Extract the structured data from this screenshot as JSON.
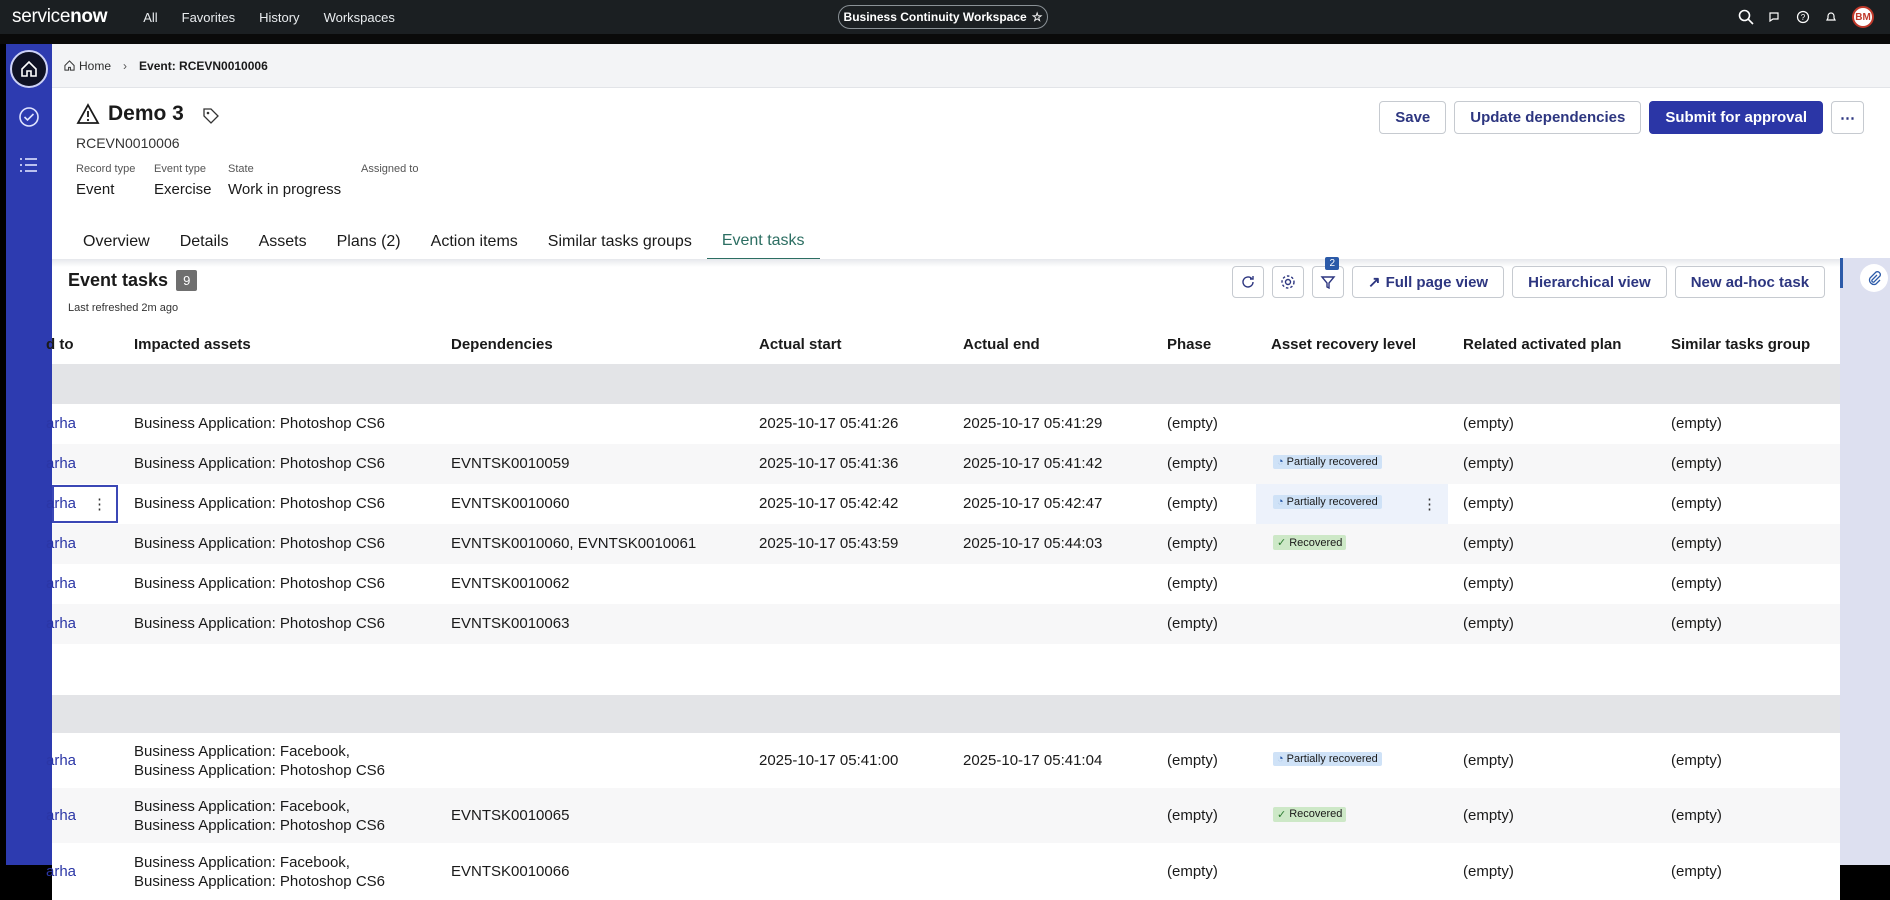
{
  "topnav": {
    "brand_a": "service",
    "brand_b": "now",
    "links": [
      "All",
      "Favorites",
      "History",
      "Workspaces"
    ],
    "workspace": "Business Continuity Workspace",
    "avatar": "BM"
  },
  "breadcrumb": {
    "home": "Home",
    "current": "Event: RCEVN0010006"
  },
  "record": {
    "title": "Demo 3",
    "number": "RCEVN0010006",
    "fields": [
      {
        "label": "Record type",
        "value": "Event"
      },
      {
        "label": "Event type",
        "value": "Exercise"
      },
      {
        "label": "State",
        "value": "Work in progress"
      },
      {
        "label": "Assigned to",
        "value": ""
      }
    ]
  },
  "actions": {
    "save": "Save",
    "update": "Update dependencies",
    "submit": "Submit for approval"
  },
  "tabs": [
    "Overview",
    "Details",
    "Assets",
    "Plans (2)",
    "Action items",
    "Similar tasks groups",
    "Event tasks"
  ],
  "panel": {
    "title": "Event tasks",
    "count": "9",
    "refreshed": "Last refreshed 2m ago",
    "filter_count": "2",
    "full_page": "Full page view",
    "hierarchical": "Hierarchical view",
    "new_task": "New ad-hoc task"
  },
  "columns": [
    "d to",
    "Impacted assets",
    "Dependencies",
    "Actual start",
    "Actual end",
    "Phase",
    "Asset recovery level",
    "Related activated plan",
    "Similar tasks group"
  ],
  "rows": [
    {
      "who": "arha",
      "assets": [
        "Business Application: Photoshop CS6"
      ],
      "deps": "",
      "start": "2025-10-17 05:41:26",
      "end": "2025-10-17 05:41:29",
      "phase": "(empty)",
      "recovery": "",
      "plan": "(empty)",
      "group": "(empty)"
    },
    {
      "who": "arha",
      "assets": [
        "Business Application: Photoshop CS6"
      ],
      "deps": "EVNTSK0010059",
      "start": "2025-10-17 05:41:36",
      "end": "2025-10-17 05:41:42",
      "phase": "(empty)",
      "recovery": "Partially recovered",
      "plan": "(empty)",
      "group": "(empty)"
    },
    {
      "who": "arha",
      "assets": [
        "Business Application: Photoshop CS6"
      ],
      "deps": "EVNTSK0010060",
      "start": "2025-10-17 05:42:42",
      "end": "2025-10-17 05:42:47",
      "phase": "(empty)",
      "recovery": "Partially recovered",
      "plan": "(empty)",
      "group": "(empty)"
    },
    {
      "who": "arha",
      "assets": [
        "Business Application: Photoshop CS6"
      ],
      "deps": "EVNTSK0010060, EVNTSK0010061",
      "start": "2025-10-17 05:43:59",
      "end": "2025-10-17 05:44:03",
      "phase": "(empty)",
      "recovery": "Recovered",
      "plan": "(empty)",
      "group": "(empty)"
    },
    {
      "who": "arha",
      "assets": [
        "Business Application: Photoshop CS6"
      ],
      "deps": "EVNTSK0010062",
      "start": "",
      "end": "",
      "phase": "(empty)",
      "recovery": "",
      "plan": "(empty)",
      "group": "(empty)"
    },
    {
      "who": "arha",
      "assets": [
        "Business Application: Photoshop CS6"
      ],
      "deps": "EVNTSK0010063",
      "start": "",
      "end": "",
      "phase": "(empty)",
      "recovery": "",
      "plan": "(empty)",
      "group": "(empty)"
    },
    {
      "who": "arha",
      "assets": [
        "Business Application: Facebook,",
        "Business Application: Photoshop CS6"
      ],
      "deps": "",
      "start": "2025-10-17 05:41:00",
      "end": "2025-10-17 05:41:04",
      "phase": "(empty)",
      "recovery": "Partially recovered",
      "plan": "(empty)",
      "group": "(empty)"
    },
    {
      "who": "arha",
      "assets": [
        "Business Application: Facebook,",
        "Business Application: Photoshop CS6"
      ],
      "deps": "EVNTSK0010065",
      "start": "",
      "end": "",
      "phase": "(empty)",
      "recovery": "Recovered",
      "plan": "(empty)",
      "group": "(empty)"
    },
    {
      "who": "arha",
      "assets": [
        "Business Application: Facebook,",
        "Business Application: Photoshop CS6"
      ],
      "deps": "EVNTSK0010066",
      "start": "",
      "end": "",
      "phase": "(empty)",
      "recovery": "",
      "plan": "(empty)",
      "group": "(empty)"
    }
  ]
}
